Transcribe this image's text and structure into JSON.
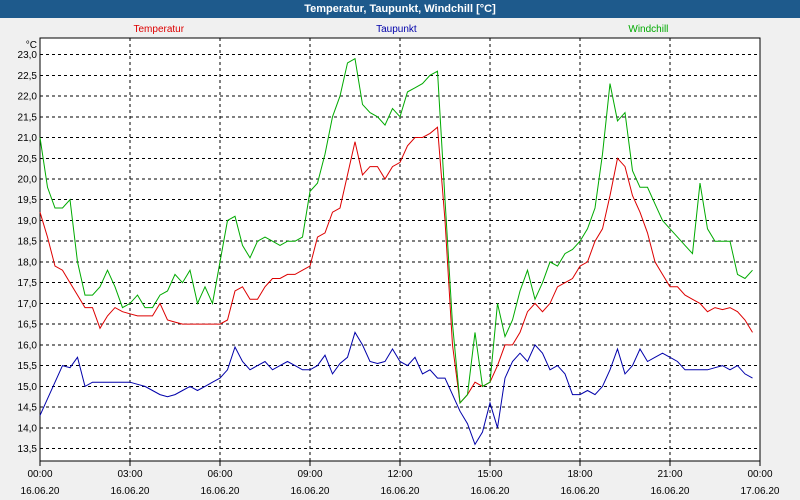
{
  "window": {
    "title": "Temperatur, Taupunkt, Windchill [°C]"
  },
  "chart_data": {
    "type": "line",
    "title": "Temperatur, Taupunkt, Windchill [°C]",
    "ylabel": "°C",
    "ylim": [
      13.2,
      23.4
    ],
    "xlim": [
      0,
      24
    ],
    "y_ticks": [
      "13,5",
      "14,0",
      "14,5",
      "15,0",
      "15,5",
      "16,0",
      "16,5",
      "17,0",
      "17,5",
      "18,0",
      "18,5",
      "19,0",
      "19,5",
      "20,0",
      "20,5",
      "21,0",
      "21,5",
      "22,0",
      "22,5",
      "23,0"
    ],
    "x_ticks": [
      {
        "time": "00:00",
        "date": "16.06.20"
      },
      {
        "time": "03:00",
        "date": "16.06.20"
      },
      {
        "time": "06:00",
        "date": "16.06.20"
      },
      {
        "time": "09:00",
        "date": "16.06.20"
      },
      {
        "time": "12:00",
        "date": "16.06.20"
      },
      {
        "time": "15:00",
        "date": "16.06.20"
      },
      {
        "time": "18:00",
        "date": "16.06.20"
      },
      {
        "time": "21:00",
        "date": "16.06.20"
      },
      {
        "time": "00:00",
        "date": "17.06.20"
      }
    ],
    "grid": true,
    "legend_position": "top",
    "series": [
      {
        "name": "Temperatur",
        "color": "#dd0000",
        "x": [
          0,
          0.25,
          0.5,
          0.75,
          1,
          1.25,
          1.5,
          1.75,
          2,
          2.25,
          2.5,
          2.75,
          3,
          3.25,
          3.5,
          3.75,
          4,
          4.25,
          4.5,
          4.75,
          5,
          5.25,
          5.5,
          5.75,
          6,
          6.25,
          6.5,
          6.75,
          7,
          7.25,
          7.5,
          7.75,
          8,
          8.25,
          8.5,
          8.75,
          9,
          9.25,
          9.5,
          9.75,
          10,
          10.25,
          10.5,
          10.75,
          11,
          11.25,
          11.5,
          11.75,
          12,
          12.25,
          12.5,
          12.75,
          13,
          13.25,
          13.5,
          13.75,
          14,
          14.25,
          14.5,
          14.75,
          15,
          15.25,
          15.5,
          15.75,
          16,
          16.25,
          16.5,
          16.75,
          17,
          17.25,
          17.5,
          17.75,
          18,
          18.25,
          18.5,
          18.75,
          19,
          19.25,
          19.5,
          19.75,
          20,
          20.25,
          20.5,
          20.75,
          21,
          21.25,
          21.5,
          21.75,
          22,
          22.25,
          22.5,
          22.75,
          23,
          23.25,
          23.5,
          23.75
        ],
        "values": [
          19.2,
          18.6,
          17.9,
          17.8,
          17.5,
          17.2,
          16.9,
          16.9,
          16.4,
          16.7,
          16.9,
          16.8,
          16.75,
          16.7,
          16.7,
          16.7,
          17.0,
          16.6,
          16.55,
          16.5,
          16.5,
          16.5,
          16.5,
          16.5,
          16.5,
          16.6,
          17.3,
          17.4,
          17.1,
          17.1,
          17.4,
          17.6,
          17.6,
          17.7,
          17.7,
          17.8,
          17.9,
          18.6,
          18.7,
          19.2,
          19.3,
          20.1,
          20.9,
          20.1,
          20.3,
          20.3,
          20.0,
          20.3,
          20.4,
          20.8,
          21.0,
          21.0,
          21.1,
          21.25,
          19.0,
          16.0,
          14.6,
          14.8,
          15.1,
          15.0,
          15.1,
          15.5,
          16.0,
          16.0,
          16.3,
          16.8,
          17.0,
          16.8,
          17.0,
          17.4,
          17.5,
          17.6,
          17.9,
          18.0,
          18.5,
          18.8,
          19.6,
          20.5,
          20.3,
          19.6,
          19.2,
          18.7,
          18.0,
          17.7,
          17.4,
          17.4,
          17.2,
          17.1,
          17.0,
          16.8,
          16.9,
          16.85,
          16.9,
          16.8,
          16.6,
          16.3
        ]
      },
      {
        "name": "Taupunkt",
        "color": "#0000aa",
        "x": [
          0,
          0.25,
          0.5,
          0.75,
          1,
          1.25,
          1.5,
          1.75,
          2,
          2.25,
          2.5,
          2.75,
          3,
          3.25,
          3.5,
          3.75,
          4,
          4.25,
          4.5,
          4.75,
          5,
          5.25,
          5.5,
          5.75,
          6,
          6.25,
          6.5,
          6.75,
          7,
          7.25,
          7.5,
          7.75,
          8,
          8.25,
          8.5,
          8.75,
          9,
          9.25,
          9.5,
          9.75,
          10,
          10.25,
          10.5,
          10.75,
          11,
          11.25,
          11.5,
          11.75,
          12,
          12.25,
          12.5,
          12.75,
          13,
          13.25,
          13.5,
          13.75,
          14,
          14.25,
          14.5,
          14.75,
          15,
          15.25,
          15.5,
          15.75,
          16,
          16.25,
          16.5,
          16.75,
          17,
          17.25,
          17.5,
          17.75,
          18,
          18.25,
          18.5,
          18.75,
          19,
          19.25,
          19.5,
          19.75,
          20,
          20.25,
          20.5,
          20.75,
          21,
          21.25,
          21.5,
          21.75,
          22,
          22.25,
          22.5,
          22.75,
          23,
          23.25,
          23.5,
          23.75
        ],
        "values": [
          14.3,
          14.7,
          15.1,
          15.5,
          15.45,
          15.7,
          15.0,
          15.1,
          15.1,
          15.1,
          15.1,
          15.1,
          15.1,
          15.05,
          15.0,
          14.9,
          14.8,
          14.75,
          14.8,
          14.9,
          15.0,
          14.9,
          15.0,
          15.1,
          15.2,
          15.4,
          15.95,
          15.6,
          15.4,
          15.5,
          15.6,
          15.4,
          15.5,
          15.6,
          15.5,
          15.4,
          15.4,
          15.5,
          15.75,
          15.3,
          15.55,
          15.7,
          16.3,
          16.0,
          15.6,
          15.55,
          15.6,
          15.9,
          15.6,
          15.5,
          15.7,
          15.3,
          15.4,
          15.2,
          15.2,
          14.8,
          14.4,
          14.1,
          13.6,
          13.9,
          14.6,
          14.0,
          15.2,
          15.6,
          15.8,
          15.6,
          16.0,
          15.8,
          15.4,
          15.5,
          15.3,
          14.8,
          14.8,
          14.9,
          14.8,
          15.0,
          15.4,
          15.9,
          15.3,
          15.5,
          15.9,
          15.6,
          15.7,
          15.8,
          15.7,
          15.6,
          15.4,
          15.4,
          15.4,
          15.4,
          15.45,
          15.5,
          15.4,
          15.5,
          15.3,
          15.2
        ]
      },
      {
        "name": "Windchill",
        "color": "#00aa00",
        "x": [
          0,
          0.25,
          0.5,
          0.75,
          1,
          1.25,
          1.5,
          1.75,
          2,
          2.25,
          2.5,
          2.75,
          3,
          3.25,
          3.5,
          3.75,
          4,
          4.25,
          4.5,
          4.75,
          5,
          5.25,
          5.5,
          5.75,
          6,
          6.25,
          6.5,
          6.75,
          7,
          7.25,
          7.5,
          7.75,
          8,
          8.25,
          8.5,
          8.75,
          9,
          9.25,
          9.5,
          9.75,
          10,
          10.25,
          10.5,
          10.75,
          11,
          11.25,
          11.5,
          11.75,
          12,
          12.25,
          12.5,
          12.75,
          13,
          13.25,
          13.5,
          13.75,
          14,
          14.25,
          14.5,
          14.75,
          15,
          15.25,
          15.5,
          15.75,
          16,
          16.25,
          16.5,
          16.75,
          17,
          17.25,
          17.5,
          17.75,
          18,
          18.25,
          18.5,
          18.75,
          19,
          19.25,
          19.5,
          19.75,
          20,
          20.25,
          20.5,
          20.75,
          21,
          21.25,
          21.5,
          21.75,
          22,
          22.25,
          22.5,
          22.75,
          23,
          23.25,
          23.5,
          23.75
        ],
        "values": [
          21.0,
          19.8,
          19.3,
          19.3,
          19.5,
          18.0,
          17.2,
          17.2,
          17.4,
          17.8,
          17.4,
          16.9,
          17.0,
          17.2,
          16.9,
          16.9,
          17.2,
          17.3,
          17.7,
          17.5,
          17.8,
          17.0,
          17.4,
          17.0,
          18.0,
          19.0,
          19.1,
          18.4,
          18.1,
          18.5,
          18.6,
          18.5,
          18.4,
          18.5,
          18.5,
          18.6,
          19.7,
          19.9,
          20.6,
          21.5,
          22.0,
          22.8,
          22.9,
          21.8,
          21.6,
          21.5,
          21.3,
          21.7,
          21.5,
          22.1,
          22.2,
          22.3,
          22.5,
          22.6,
          19.5,
          16.5,
          14.6,
          14.8,
          16.3,
          15.0,
          15.1,
          17.0,
          16.2,
          16.6,
          17.3,
          17.8,
          17.1,
          17.5,
          18.0,
          17.9,
          18.2,
          18.3,
          18.5,
          18.8,
          19.3,
          20.6,
          22.3,
          21.4,
          21.6,
          20.2,
          19.8,
          19.8,
          19.4,
          19.0,
          18.8,
          18.6,
          18.4,
          18.2,
          19.9,
          18.8,
          18.5,
          18.5,
          18.5,
          17.7,
          17.6,
          17.8
        ]
      }
    ]
  }
}
